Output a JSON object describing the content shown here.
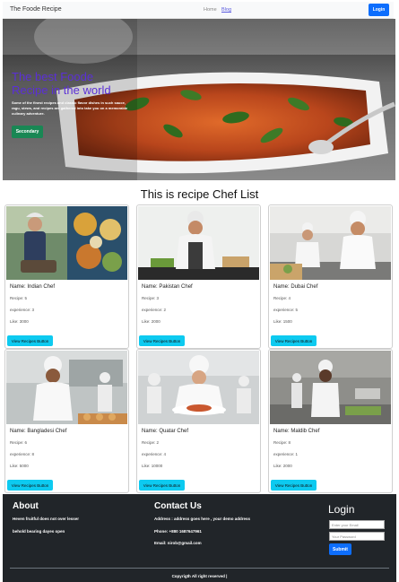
{
  "navbar": {
    "brand": "The Foode Recipe",
    "links": [
      "Home",
      "Blog"
    ],
    "login_label": "Login"
  },
  "hero": {
    "title": "The best Foode Recipe in the world",
    "text": "Some of the finest recipes and classic flavor dishes in such sauce, ragu, stews, and recipes are gathered into take you on a memorable culinary adventure.",
    "button_label": "Secondary"
  },
  "section_title": "This is recipe Chef List",
  "chefs": [
    {
      "name": "Name: Indian Chef",
      "recipe": "Recipe: 5",
      "experience": "experience: 3",
      "like": "Like: 3000",
      "button": "View Recipes Button"
    },
    {
      "name": "Name: Pakistan Chef",
      "recipe": "Recipe: 3",
      "experience": "experience: 2",
      "like": "Like: 2000",
      "button": "View Recipes Button"
    },
    {
      "name": "Name: Dubai Chef",
      "recipe": "Recipe: 4",
      "experience": "experience: 5",
      "like": "Like: 1500",
      "button": "View Recipes Button"
    },
    {
      "name": "Name: Bangladesi Chef",
      "recipe": "Recipe: 6",
      "experience": "experience: 8",
      "like": "Like: 5000",
      "button": "View Recipes Button"
    },
    {
      "name": "Name: Quatar Chef",
      "recipe": "Recipe: 2",
      "experience": "experience: 4",
      "like": "Like: 10000",
      "button": "View Recipes Button"
    },
    {
      "name": "Name: Maldib Chef",
      "recipe": "Recipe: 8",
      "experience": "experience: 1",
      "like": "Like: 2000",
      "button": "View Recipes Button"
    }
  ],
  "footer": {
    "about_heading": "About",
    "about_lines": [
      "Heven fruitful does not over lesser",
      "behold bearing dayes open"
    ],
    "contact_heading": "Contact Us",
    "contact_lines": [
      "Address : address goes here , your demo address",
      "Phone: +880 1687647961",
      "Email: nirob@gmail.com"
    ],
    "login_heading": "Login",
    "email_placeholder": "Enter your Email",
    "password_placeholder": "Your Password",
    "submit_label": "Submit",
    "copyright": "Copyrigth All right reserved |"
  },
  "colors": {
    "primary": "#0d6efd",
    "success": "#198754",
    "info": "#0dcaf0",
    "footer_bg": "#212529",
    "hero_title": "#5b2fd6"
  }
}
